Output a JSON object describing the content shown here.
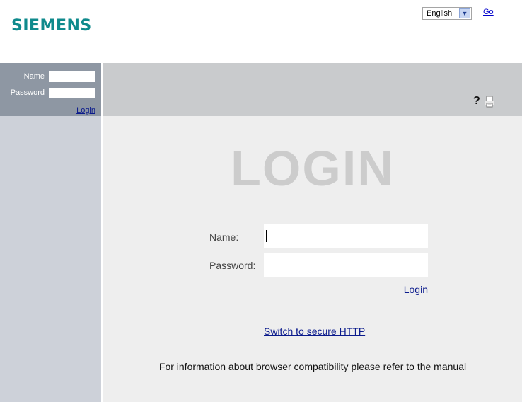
{
  "header": {
    "brand": "SIEMENS",
    "language_selected": "English",
    "go_label": "Go"
  },
  "sidebar": {
    "name_label": "Name",
    "password_label": "Password",
    "login_link": "Login"
  },
  "toolbar": {
    "help_icon": "question-mark-icon",
    "print_icon": "printer-icon",
    "help_glyph": "?"
  },
  "main": {
    "title": "LOGIN",
    "name_label": "Name:",
    "password_label": "Password:",
    "name_value": "",
    "password_value": "",
    "login_link": "Login",
    "secure_link": "Switch to secure HTTP",
    "info_text": "For information about browser compatibility please refer to the manual"
  },
  "colors": {
    "brand": "#0f8a8c",
    "sidebar_header": "#8e97a3",
    "sidebar": "#cdd1d9",
    "topbar": "#c9cbcd",
    "main_bg": "#eeeeee",
    "link": "#0a1a8c"
  }
}
